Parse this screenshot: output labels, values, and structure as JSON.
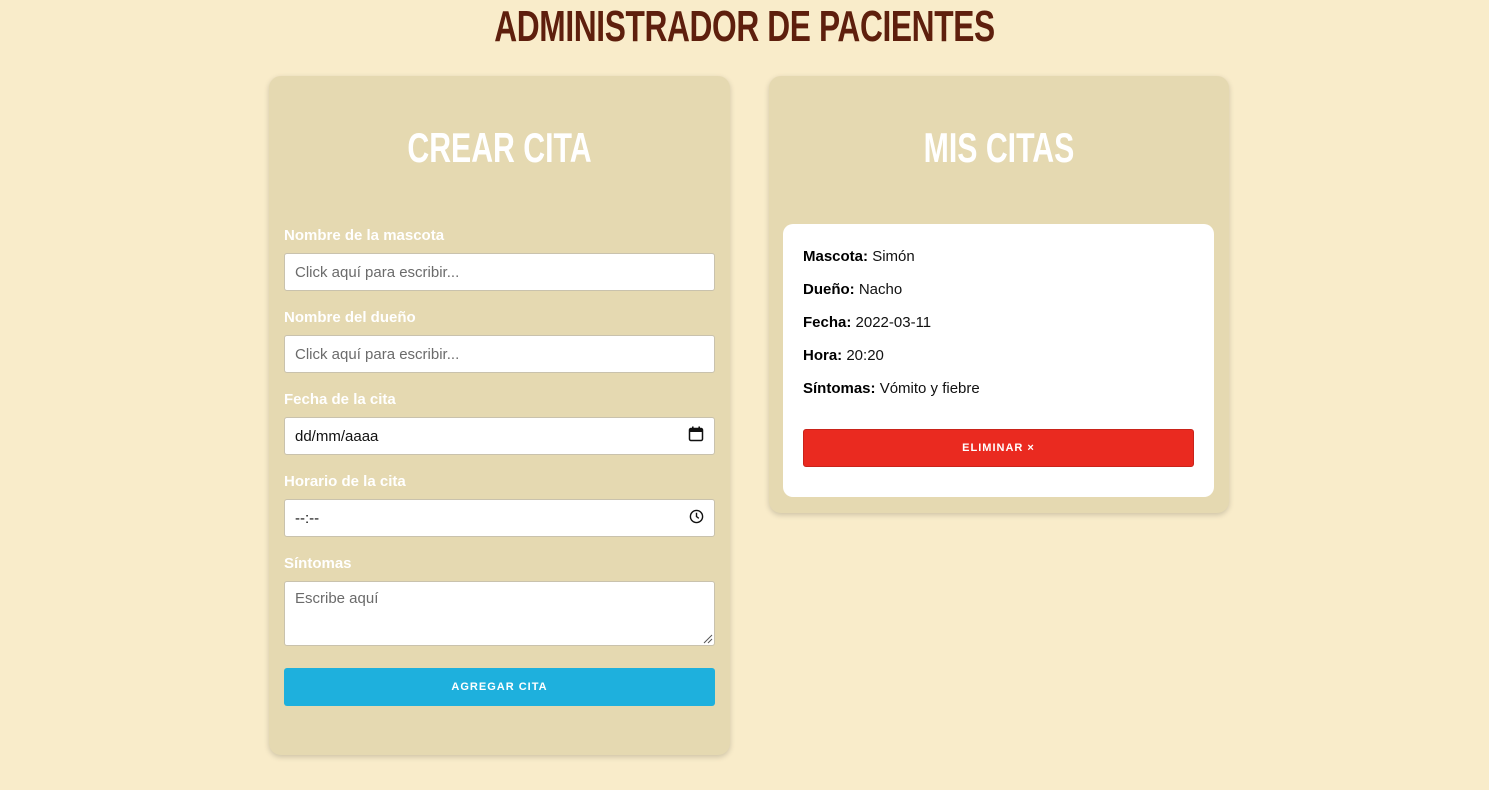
{
  "header": {
    "title": "Administrador de Pacientes"
  },
  "form": {
    "title": "Crear Cita",
    "fields": {
      "mascota": {
        "label": "Nombre de la mascota",
        "placeholder": "Click aquí para escribir..."
      },
      "dueno": {
        "label": "Nombre del dueño",
        "placeholder": "Click aquí para escribir..."
      },
      "fecha": {
        "label": "Fecha de la cita",
        "value": "dd/mm/aaaa"
      },
      "hora": {
        "label": "Horario de la cita",
        "value": "--:--"
      },
      "sintomas": {
        "label": "Síntomas",
        "placeholder": "Escribe aquí"
      }
    },
    "submit_label": "Agregar cita"
  },
  "list": {
    "title": "Mis citas",
    "citas": [
      {
        "mascota_label": "Mascota:",
        "mascota": "Simón",
        "dueno_label": "Dueño:",
        "dueno": "Nacho",
        "fecha_label": "Fecha:",
        "fecha": "2022-03-11",
        "hora_label": "Hora:",
        "hora": "20:20",
        "sintomas_label": "Síntomas:",
        "sintomas": "Vómito y fiebre",
        "delete_label": "Eliminar ×"
      }
    ]
  },
  "colors": {
    "background": "#f9ecca",
    "card": "#e5d9b1",
    "title": "#5e1f0d",
    "primary_button": "#1eb0dd",
    "danger_button": "#ea2a20"
  },
  "icons": {
    "date": "calendar-icon",
    "time": "clock-icon"
  }
}
